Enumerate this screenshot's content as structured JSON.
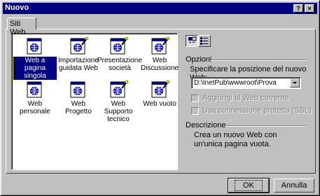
{
  "window": {
    "title": "Nuovo",
    "help_label": "?",
    "close_label": "×"
  },
  "tab": {
    "label": "Siti Web"
  },
  "templates": [
    {
      "label": "Web a pagina singola",
      "icon": "single-page-web-icon",
      "selected": true
    },
    {
      "label": "Importazione guidata Web",
      "icon": "import-wizard-icon",
      "selected": false
    },
    {
      "label": "Presentazione società",
      "icon": "company-presentation-icon",
      "selected": false
    },
    {
      "label": "Web Discussione",
      "icon": "discussion-web-icon",
      "selected": false
    },
    {
      "label": "Web personale",
      "icon": "personal-web-icon",
      "selected": false
    },
    {
      "label": "Web Progetto",
      "icon": "project-web-icon",
      "selected": false
    },
    {
      "label": "Web Supporto tecnico",
      "icon": "support-web-icon",
      "selected": false
    },
    {
      "label": "Web vuoto",
      "icon": "empty-web-icon",
      "selected": false
    }
  ],
  "options": {
    "heading": "Opzioni",
    "location_label": "Specificare la posizione del nuovo Web:",
    "location_value": "D:\\InetPub\\wwwroot\\Prova",
    "add_to_current_label": "Aggiungi al Web corrente",
    "add_to_current_checked": false,
    "secure_connection_label": "Usa connessione protetta (SSL)",
    "secure_connection_checked": false
  },
  "description": {
    "heading": "Descrizione",
    "text": "Crea un nuovo Web con un'unica pagina vuota."
  },
  "buttons": {
    "ok": "OK",
    "cancel": "Annulla"
  },
  "colors": {
    "titlebar": "#000080",
    "face": "#c0c0c0",
    "selection": "#000080"
  }
}
